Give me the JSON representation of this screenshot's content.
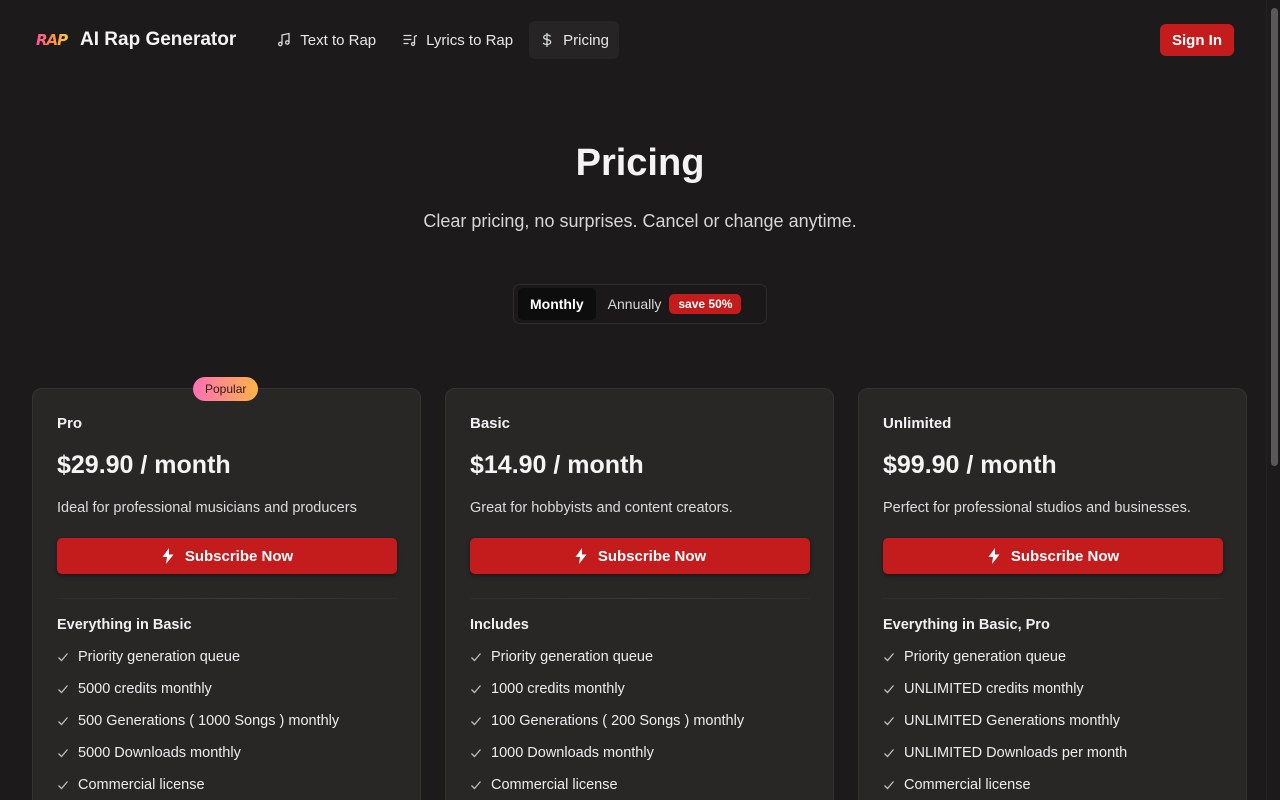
{
  "header": {
    "logo_mark": "RAP",
    "app_title": "AI Rap Generator",
    "nav": [
      {
        "label": "Text to Rap",
        "icon": "music-note-icon"
      },
      {
        "label": "Lyrics to Rap",
        "icon": "music-list-icon"
      },
      {
        "label": "Pricing",
        "icon": "dollar-icon"
      }
    ],
    "active_nav": "Pricing",
    "signin_label": "Sign In"
  },
  "hero": {
    "title": "Pricing",
    "subtitle": "Clear pricing, no surprises. Cancel or change anytime."
  },
  "billing_toggle": {
    "monthly_label": "Monthly",
    "annually_label": "Annually",
    "save_badge": "save 50%",
    "selected": "Monthly"
  },
  "plans": [
    {
      "name": "Pro",
      "badge": "Popular",
      "price": "$29.90 / month",
      "description": "Ideal for professional musicians and producers",
      "cta": "Subscribe Now",
      "features_heading": "Everything in Basic",
      "features": [
        "Priority generation queue",
        "5000 credits monthly",
        "500 Generations ( 1000 Songs ) monthly",
        "5000 Downloads monthly",
        "Commercial license"
      ]
    },
    {
      "name": "Basic",
      "price": "$14.90 / month",
      "description": "Great for hobbyists and content creators.",
      "cta": "Subscribe Now",
      "features_heading": "Includes",
      "features": [
        "Priority generation queue",
        "1000 credits monthly",
        "100 Generations ( 200 Songs ) monthly",
        "1000 Downloads monthly",
        "Commercial license"
      ]
    },
    {
      "name": "Unlimited",
      "price": "$99.90 / month",
      "description": "Perfect for professional studios and businesses.",
      "cta": "Subscribe Now",
      "features_heading": "Everything in Basic, Pro",
      "features": [
        "Priority generation queue",
        "UNLIMITED credits monthly",
        "UNLIMITED Generations monthly",
        "UNLIMITED Downloads per month",
        "Commercial license"
      ]
    }
  ],
  "colors": {
    "background": "#1c1a1a",
    "card": "#292626",
    "accent_red": "#c41c1c",
    "popular_gradient_start": "#ff6fb5",
    "popular_gradient_end": "#ffb347"
  }
}
